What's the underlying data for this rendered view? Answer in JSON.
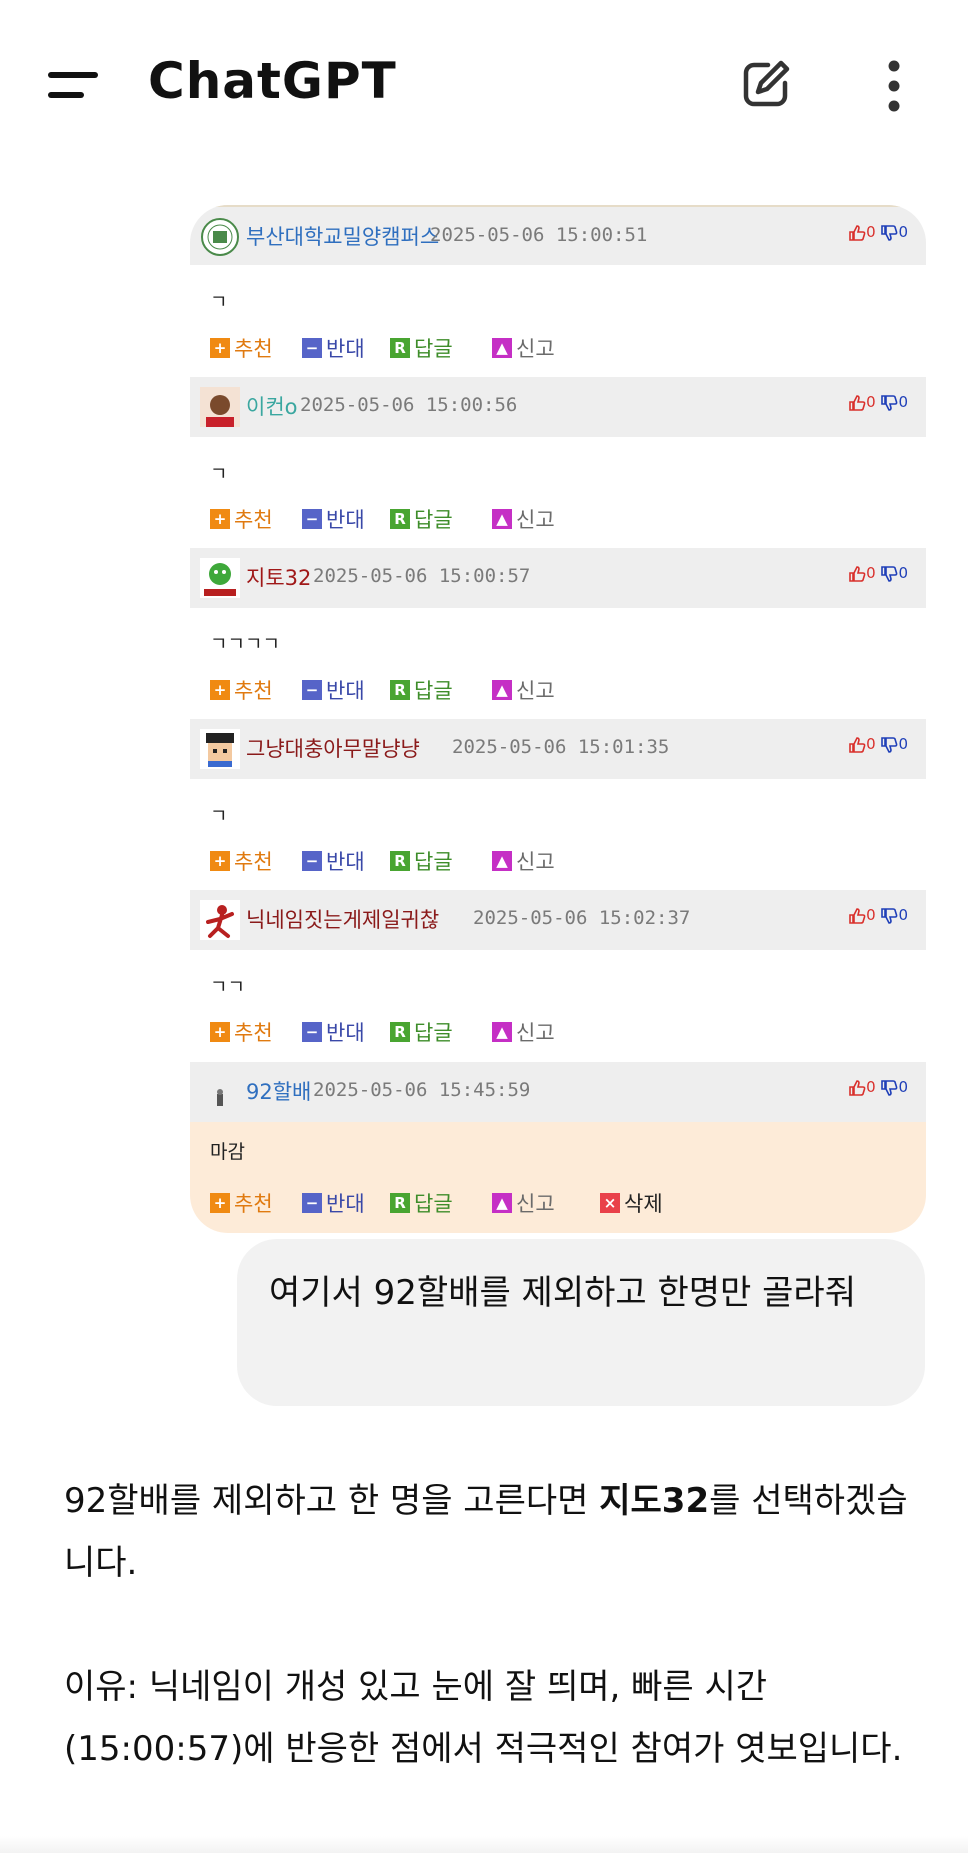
{
  "appbar": {
    "title": "ChatGPT",
    "menu_icon": "hamburger-menu-icon",
    "new_chat_icon": "edit-pencil-icon",
    "more_icon": "more-vertical-icon"
  },
  "comments": [
    {
      "nick": "부산대학교밀양캠퍼스",
      "nick_color": "#2f6fbf",
      "time": "2025-05-06 15:00:51",
      "up": "0",
      "down": "0",
      "body": "ㄱ"
    },
    {
      "nick": "이컨o",
      "nick_color": "#3aa7a0",
      "time": "2025-05-06 15:00:56",
      "up": "0",
      "down": "0",
      "body": "ㄱ"
    },
    {
      "nick": "지토32",
      "nick_color": "#a01818",
      "time": "2025-05-06 15:00:57",
      "up": "0",
      "down": "0",
      "body": "ㄱㄱㄱㄱ"
    },
    {
      "nick": "그냥대충아무말냥냥",
      "nick_color": "#8a1a1a",
      "time": "2025-05-06 15:01:35",
      "up": "0",
      "down": "0",
      "body": "ㄱ"
    },
    {
      "nick": "닉네임짓는게제일귀찮",
      "nick_color": "#8a1a1a",
      "time": "2025-05-06 15:02:37",
      "up": "0",
      "down": "0",
      "body": "ㄱㄱ"
    },
    {
      "nick": "92할배",
      "nick_color": "#2f6fbf",
      "time": "2025-05-06 15:45:59",
      "up": "0",
      "down": "0",
      "body": "마감"
    }
  ],
  "actions": {
    "recommend": "추천",
    "oppose": "반대",
    "reply": "답글",
    "report": "신고",
    "delete": "삭제"
  },
  "user_message": "여기서 92할배를 제외하고 한명만 골라줘",
  "assistant": {
    "p1_before": "92할배를 제외하고 한 명을 고른다면 ",
    "p1_bold": "지도32",
    "p1_after": "를 선택하겠습니다.",
    "p2": "이유: 닉네임이 개성 있고 눈에 잘 띄며, 빠른 시간(15:00:57)에 반응한 점에서 적극적인 참여가 엿보입니다."
  },
  "colors": {
    "accent_orange": "#f08a12",
    "oppose_blue": "#5664c8",
    "reply_green": "#49a531",
    "report_magenta": "#c52fc5",
    "delete_red": "#e9414a",
    "own_comment_bg": "#fdebd8",
    "user_bubble_bg": "#f2f2f2"
  }
}
